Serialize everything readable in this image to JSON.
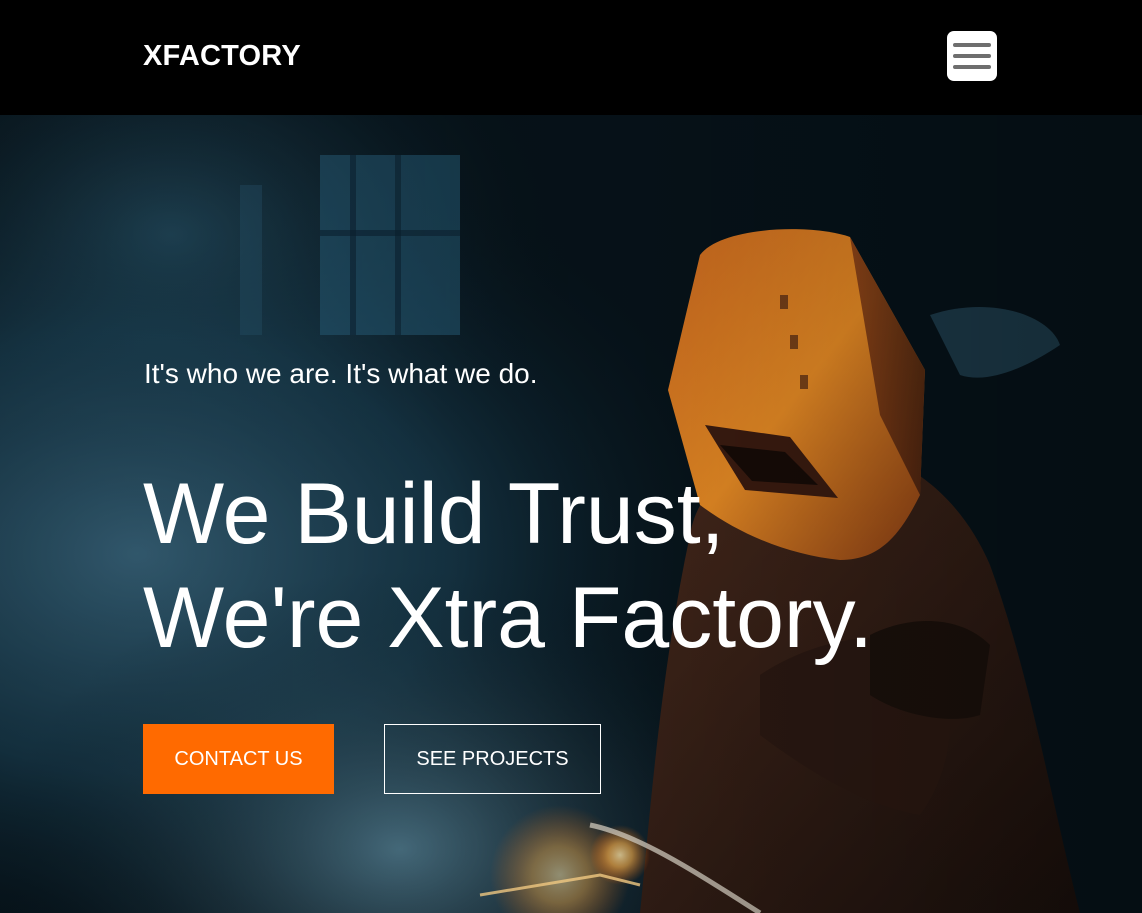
{
  "navbar": {
    "brand": "XFACTORY",
    "menu_icon": "hamburger-menu-icon"
  },
  "hero": {
    "background_image": "welder-with-protective-helmet-photo",
    "tagline": "It's who we are. It's what we do.",
    "headline_line1": "We Build Trust,",
    "headline_line2": "We're Xtra Factory.",
    "contact_label": "CONTACT US",
    "projects_label": "SEE PROJECTS"
  },
  "colors": {
    "accent": "#ff6a00",
    "navbar_bg": "#000000",
    "text": "#ffffff"
  }
}
